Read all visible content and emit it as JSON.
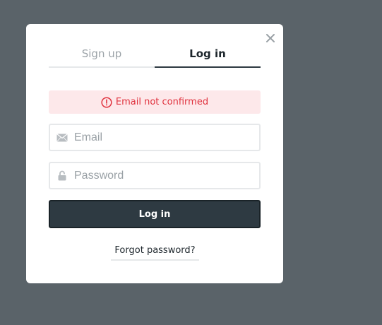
{
  "dialog": {
    "close_label": "×",
    "tabs": [
      {
        "label": "Sign up",
        "active": false
      },
      {
        "label": "Log in",
        "active": true
      }
    ],
    "alert": {
      "message": "Email not confirmed",
      "icon": "alert-circle-icon",
      "color": "#e0313d"
    },
    "email": {
      "placeholder": "Email",
      "value": "",
      "icon": "envelope-icon"
    },
    "password": {
      "placeholder": "Password",
      "value": "",
      "icon": "lock-icon"
    },
    "submit_label": "Log in",
    "forgot_label": "Forgot password?"
  }
}
